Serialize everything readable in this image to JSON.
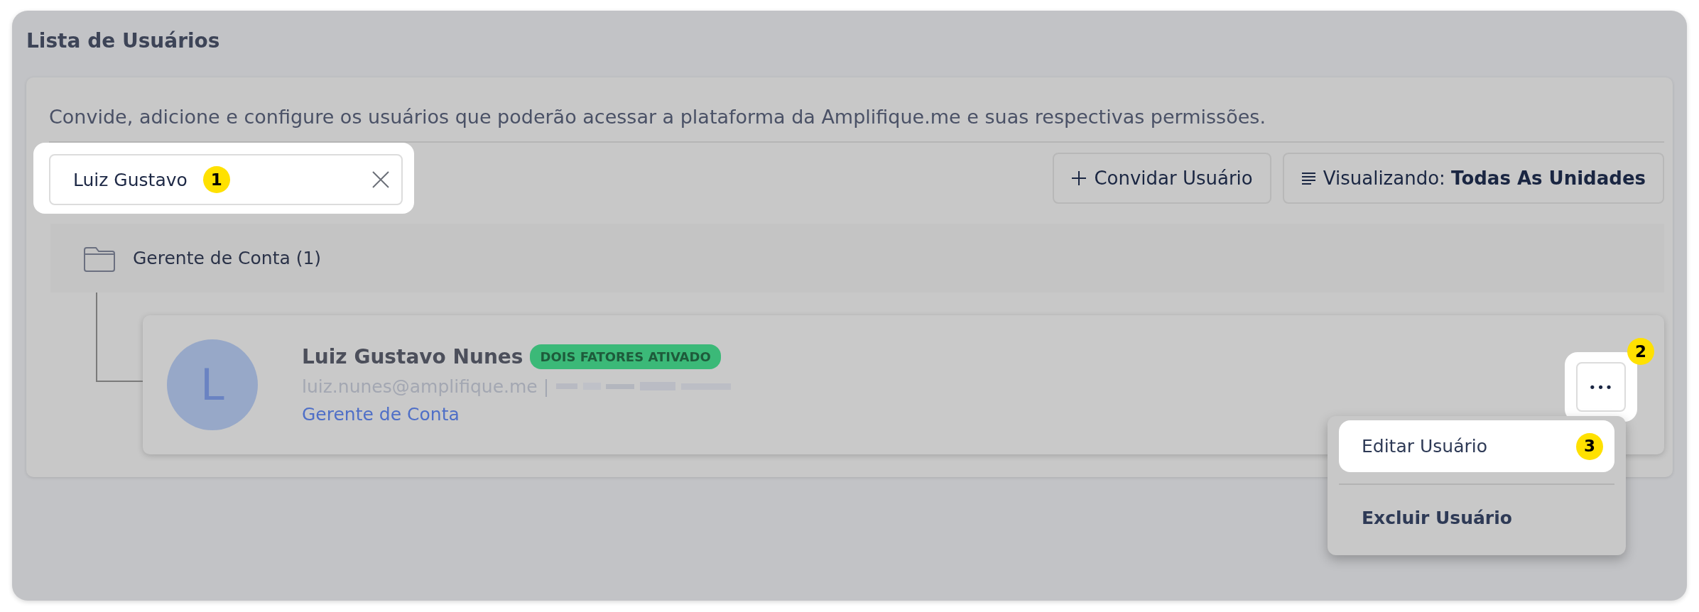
{
  "panel": {
    "title": "Lista de Usuários"
  },
  "description": "Convide, adicione e configure os usuários que poderão acessar a plataforma da Amplifique.me e suas respectivas permissões.",
  "search": {
    "value": "Luiz Gustavo",
    "highlighted": true,
    "step": "1"
  },
  "buttons": [
    {
      "kind": "invite",
      "label": "Convidar Usuário"
    },
    {
      "kind": "view",
      "label": "Visualizando: **Todas As Unidades**"
    }
  ],
  "group": {
    "label": "Gerente de Conta (1)",
    "users": [
      {
        "initial": "L",
        "name": "Luiz Gustavo Nunes",
        "badge": "DOIS FATORES ATIVADO",
        "email": "luiz.nunes@amplifique.me",
        "separator": "|",
        "role": "Gerente de Conta",
        "more_button": {
          "label": "•••",
          "highlighted": true,
          "step": "2"
        },
        "menu": [
          {
            "label": "Editar Usuário",
            "highlighted": true,
            "bold": false,
            "step": "3"
          },
          {
            "label": "Excluir Usuário",
            "highlighted": false,
            "bold": true
          }
        ]
      }
    ]
  }
}
